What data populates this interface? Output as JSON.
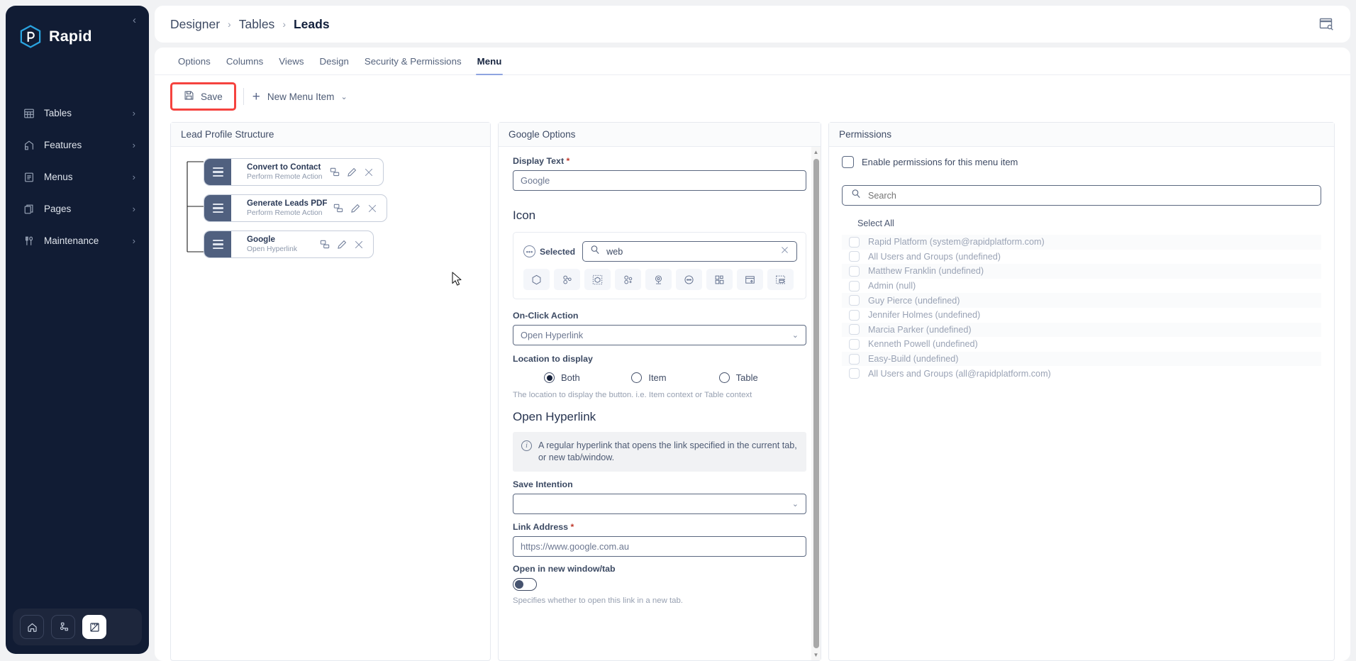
{
  "sidebar": {
    "brand": "Rapid",
    "collapse_icon": "chevron-left-icon",
    "items": [
      {
        "label": "Tables",
        "icon": "table-icon",
        "chevron": "›"
      },
      {
        "label": "Features",
        "icon": "features-icon",
        "chevron": "›"
      },
      {
        "label": "Menus",
        "icon": "menu-list-icon",
        "chevron": "›"
      },
      {
        "label": "Pages",
        "icon": "pages-icon",
        "chevron": "›"
      },
      {
        "label": "Maintenance",
        "icon": "tools-icon",
        "chevron": "›"
      }
    ],
    "bottom_buttons": [
      {
        "name": "home-icon"
      },
      {
        "name": "sitemap-icon"
      },
      {
        "name": "designer-icon"
      }
    ]
  },
  "topbar": {
    "breadcrumb": [
      "Designer",
      "Tables",
      "Leads"
    ],
    "separator": "›",
    "right_icon": "window-search-icon"
  },
  "tabs": [
    {
      "label": "Options",
      "active": false
    },
    {
      "label": "Columns",
      "active": false
    },
    {
      "label": "Views",
      "active": false
    },
    {
      "label": "Design",
      "active": false
    },
    {
      "label": "Security & Permissions",
      "active": false
    },
    {
      "label": "Menu",
      "active": true
    }
  ],
  "toolbar": {
    "save_label": "Save",
    "save_icon": "save-disk-icon",
    "new_menu_item_label": "New Menu Item",
    "new_menu_item_caret": "⌄",
    "highlight_color": "#f5433f"
  },
  "left_panel": {
    "title": "Lead Profile Structure",
    "nodes": [
      {
        "title": "Convert to Contact",
        "subtitle": "Perform Remote Action"
      },
      {
        "title": "Generate Leads PDF",
        "subtitle": "Perform Remote Action"
      },
      {
        "title": "Google",
        "subtitle": "Open Hyperlink"
      }
    ],
    "node_actions": [
      "duplicate-icon",
      "edit-pencil-icon",
      "delete-x-icon"
    ]
  },
  "mid_panel": {
    "title": "Google Options",
    "display_text_label": "Display Text",
    "display_text_required": "*",
    "display_text_value": "Google",
    "icon_section_title": "Icon",
    "selected_label": "Selected",
    "icon_search_value": "web",
    "icon_search_icon": "search-icon",
    "icon_clear_icon": "clear-x-icon",
    "icon_results": [
      "hexagon-outline-icon",
      "molecule-icon",
      "selection-hexagon-icon",
      "molecule-add-icon",
      "webcam-icon",
      "circle-ellipsis-icon",
      "widgets-icon",
      "window-upload-icon",
      "window-dashed-icon"
    ],
    "onclick_label": "On-Click Action",
    "onclick_value": "Open Hyperlink",
    "location_label": "Location to display",
    "location_options": [
      {
        "label": "Both",
        "selected": true
      },
      {
        "label": "Item",
        "selected": false
      },
      {
        "label": "Table",
        "selected": false
      }
    ],
    "location_hint": "The location to display the button. i.e. Item context or Table context",
    "hyperlink_section_title": "Open Hyperlink",
    "info_text": "A regular hyperlink that opens the link specified in the current tab, or new tab/window.",
    "save_intention_label": "Save Intention",
    "save_intention_value": "",
    "link_address_label": "Link Address",
    "link_address_required": "*",
    "link_address_value": "https://www.google.com.au",
    "open_new_window_label": "Open in new window/tab",
    "open_new_window_on": false,
    "open_new_window_hint": "Specifies whether to open this link in a new tab."
  },
  "right_panel": {
    "title": "Permissions",
    "enable_label": "Enable permissions for this menu item",
    "enable_checked": false,
    "search_placeholder": "Search",
    "search_icon": "search-icon",
    "select_all_label": "Select All",
    "users": [
      "Rapid Platform (system@rapidplatform.com)",
      "All Users and Groups (undefined)",
      "Matthew Franklin (undefined)",
      "Admin (null)",
      "Guy Pierce (undefined)",
      "Jennifer Holmes (undefined)",
      "Marcia Parker (undefined)",
      "Kenneth Powell (undefined)",
      "Easy-Build (undefined)",
      "All Users and Groups (all@rapidplatform.com)"
    ]
  }
}
